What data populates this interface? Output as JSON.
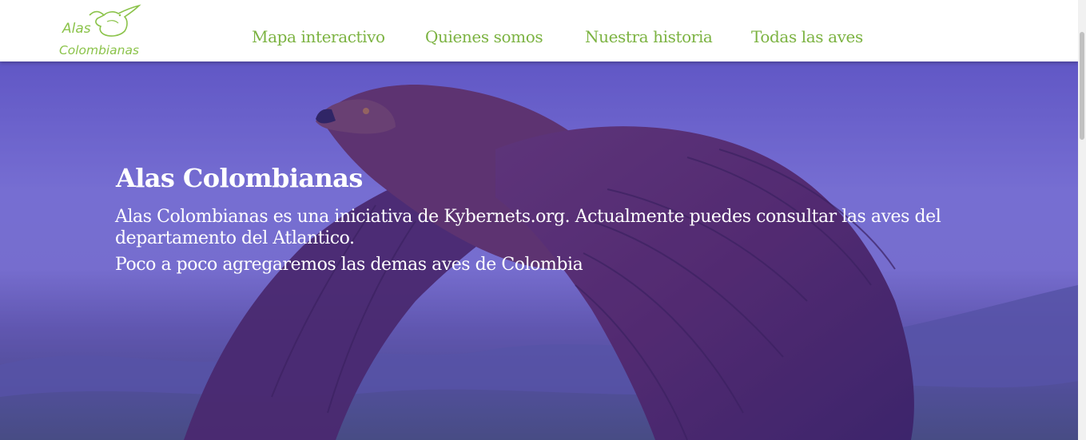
{
  "header": {
    "logo_text_line1": "Alas",
    "logo_text_line2": "Colombianas",
    "nav": [
      {
        "label": "Mapa interactivo"
      },
      {
        "label": "Quienes somos"
      },
      {
        "label": "Nuestra historia"
      },
      {
        "label": "Todas las aves"
      }
    ]
  },
  "hero": {
    "title": "Alas Colombianas",
    "paragraph1": "Alas Colombianas es una iniciativa de Kybernets.org. Actualmente puedes consultar las aves del departamento del Atlantico.",
    "paragraph2": "Poco a poco agregaremos las demas aves de Colombia",
    "image_subject": "eagle-in-flight"
  },
  "colors": {
    "nav_green": "#7cb342",
    "logo_green": "#8bc34a",
    "hero_tint": "#6f6ac4",
    "hero_text": "#ffffff"
  }
}
